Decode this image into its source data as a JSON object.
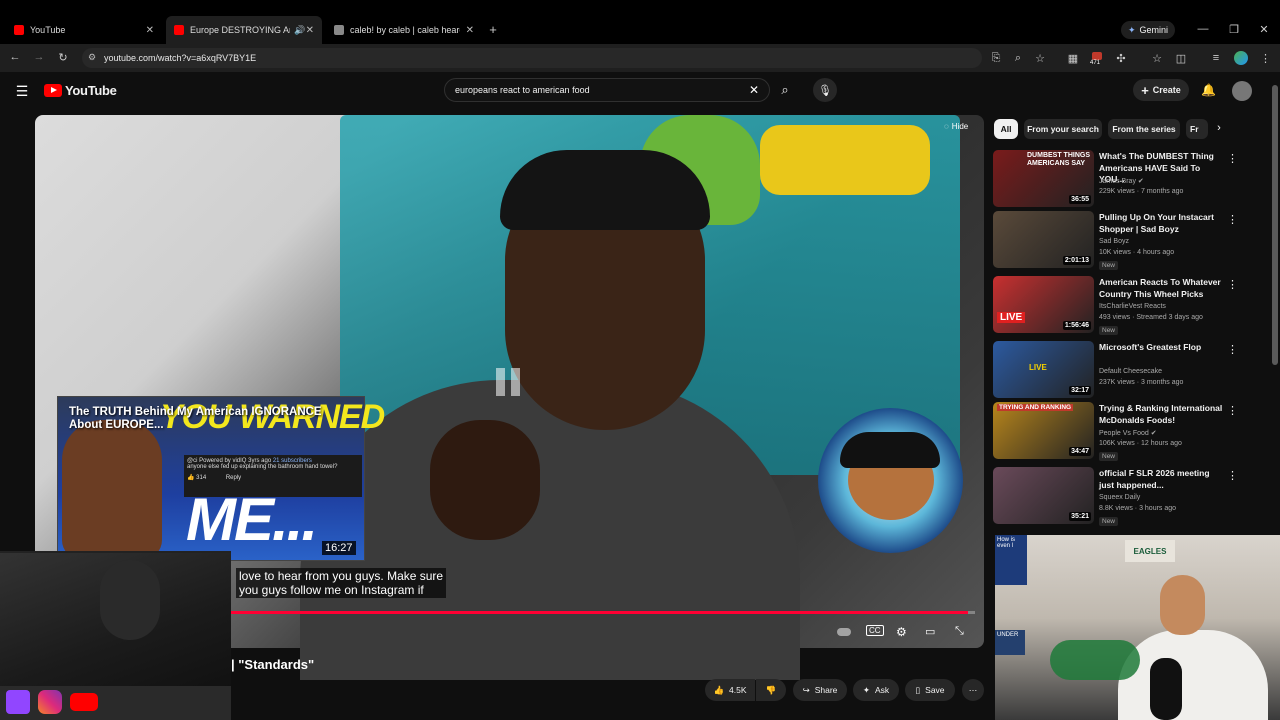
{
  "browser": {
    "tabs": [
      {
        "title": "YouTube",
        "active": false
      },
      {
        "title": "Europe DESTROYING Ame",
        "active": true
      },
      {
        "title": "caleb! by caleb | caleb hearon |",
        "active": false
      }
    ],
    "url": "youtube.com/watch?v=a6xqRV7BY1E",
    "gemini_label": "Gemini",
    "extension_badge": "471"
  },
  "youtube": {
    "logo_text": "YouTube",
    "search_value": "europeans react to american food",
    "create_label": "Create"
  },
  "player": {
    "hide_label": "Hide",
    "captions": [
      "love to hear from you guys. Make sure",
      "you guys follow me on Instagram if"
    ],
    "progress_fraction": 0.99,
    "cc_label": "CC",
    "title_fragment": "| \"Standards\""
  },
  "pip_overlay": {
    "title": "The TRUTH Behind My American IGNORANCE About EUROPE...",
    "banner_text": "YOU WARNED",
    "big_text": "ME...",
    "comment_handle": "@ci",
    "comment_powered": "Powered by vidIQ",
    "comment_time": "3yrs ago",
    "comment_subs": "21 subscribers",
    "comment_text": "anyone else fed up explaining the bathroom hand towel?",
    "comment_likes": "314",
    "comment_reply": "Reply",
    "duration": "16:27"
  },
  "actions": {
    "likes": "4.5K",
    "share": "Share",
    "ask": "Ask",
    "save": "Save"
  },
  "filter_chips": [
    "All",
    "From your search",
    "From the series",
    "Fr"
  ],
  "recommendations": [
    {
      "title": "What's The DUMBEST Thing Americans HAVE Said To YOU...",
      "channel": "James Bray",
      "verified": true,
      "meta": "229K views · 7 months ago",
      "duration": "36:55",
      "new": false,
      "thumb_color": "#7a1b1b"
    },
    {
      "title": "Pulling Up On Your Instacart Shopper | Sad Boyz",
      "channel": "Sad Boyz",
      "verified": false,
      "meta": "10K views · 4 hours ago",
      "duration": "2:01:13",
      "new": true,
      "thumb_color": "#5a4a3a"
    },
    {
      "title": "American Reacts To Whatever Country This Wheel Picks",
      "channel": "ItsCharlieVest Reacts",
      "verified": false,
      "meta": "493 views · Streamed 3 days ago",
      "duration": "1:56:46",
      "new": true,
      "thumb_color": "#c83030"
    },
    {
      "title": "Microsoft's Greatest Flop",
      "channel": "Default Cheesecake",
      "verified": false,
      "meta": "237K views · 3 months ago",
      "duration": "32:17",
      "new": false,
      "thumb_color": "#2c5aa0"
    },
    {
      "title": "Trying & Ranking International McDonalds Foods!",
      "channel": "People Vs Food",
      "verified": true,
      "meta": "106K views · 12 hours ago",
      "duration": "34:47",
      "new": true,
      "thumb_color": "#b8861c"
    },
    {
      "title": "official F SLR 2026 meeting just happened...",
      "channel": "Squeex Daily",
      "verified": false,
      "meta": "8.8K views · 3 hours ago",
      "duration": "35:21",
      "new": true,
      "thumb_color": "#6a4a5a"
    }
  ],
  "rec_labels": {
    "live": "LIVE",
    "new": "New",
    "thumb1_text": "DUMBEST THINGS AMERICANS SAY",
    "thumb3_text": "LIVE",
    "thumb5_text": "TRYING AND RANKING"
  },
  "stream_overlay": {
    "sign_text": "EAGLES",
    "small_text_1": "How is",
    "small_text_2": "even l",
    "small_text_3": "UNDER"
  },
  "colors": {
    "accent": "#ff0033",
    "bg": "#0f0f0f",
    "chip": "#272727"
  }
}
